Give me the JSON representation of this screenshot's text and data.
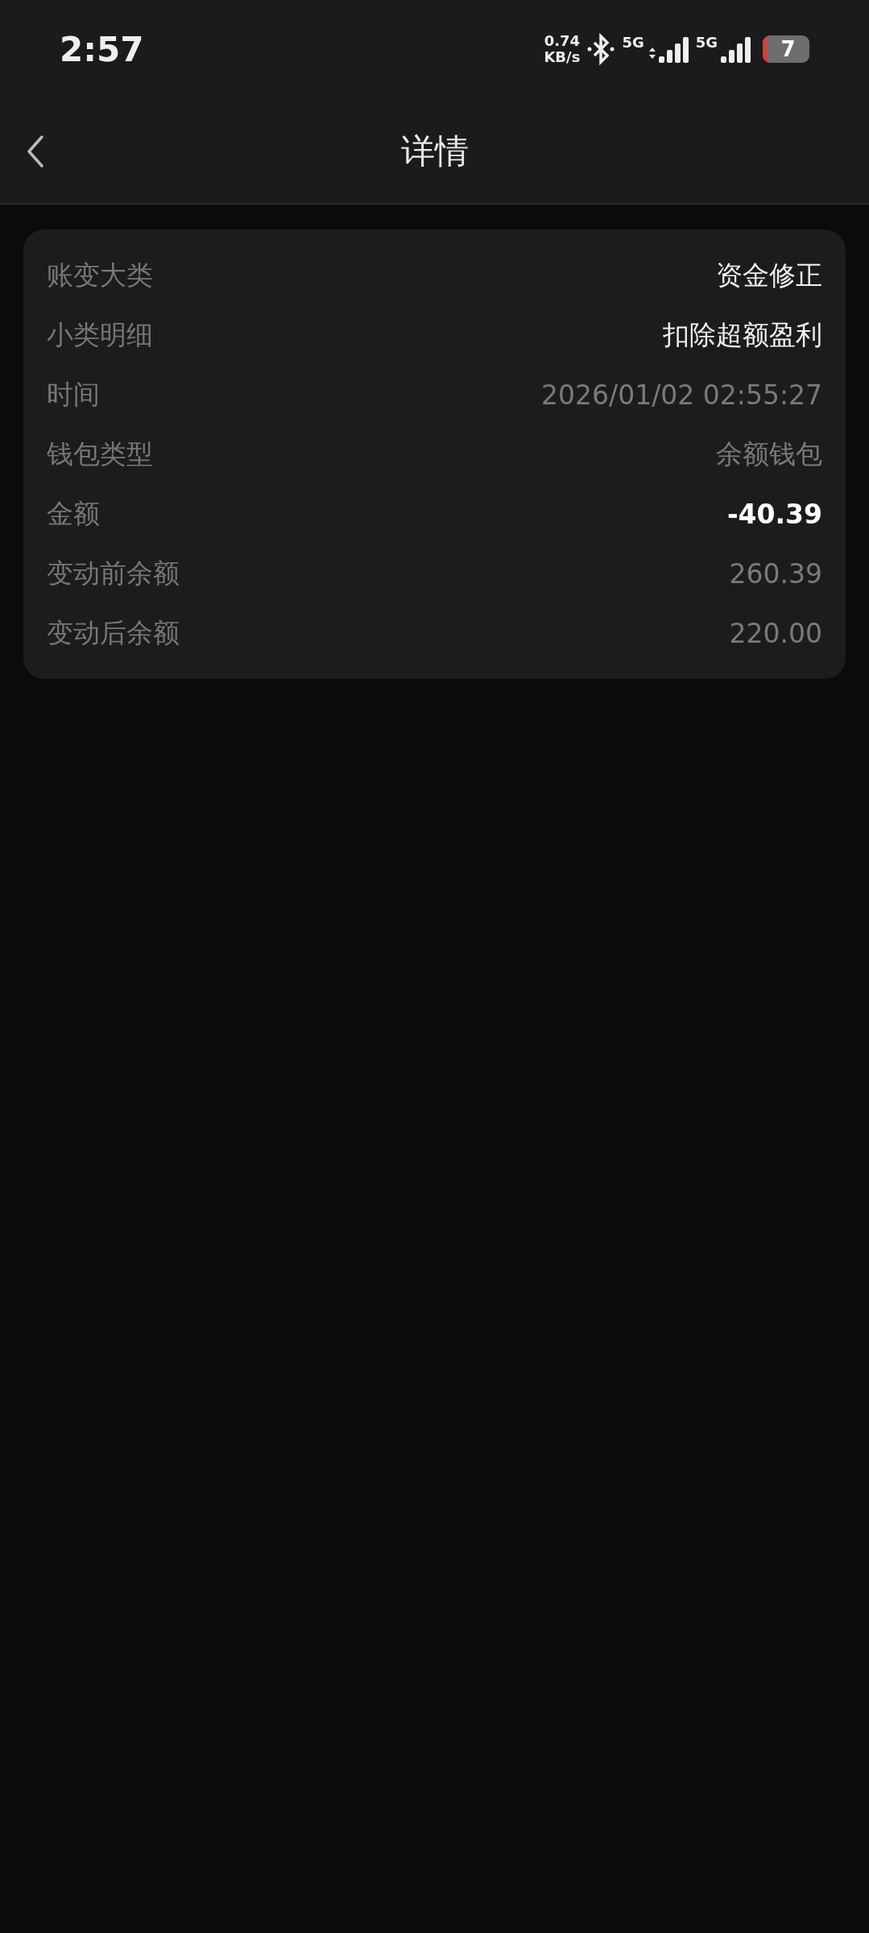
{
  "status_bar": {
    "time": "2:57",
    "speed_value": "0.74",
    "speed_unit": "KB/s",
    "networks": [
      "5G",
      "5G"
    ],
    "battery": "7"
  },
  "header": {
    "title": "详情"
  },
  "details": [
    {
      "label": "账变大类",
      "value": "资金修正",
      "kind": "highlight"
    },
    {
      "label": "小类明细",
      "value": "扣除超额盈利",
      "kind": "highlight"
    },
    {
      "label": "时间",
      "value": "2026/01/02 02:55:27",
      "kind": "plain"
    },
    {
      "label": "钱包类型",
      "value": "余额钱包",
      "kind": "plain"
    },
    {
      "label": "金额",
      "value": "-40.39",
      "kind": "bold"
    },
    {
      "label": "变动前余额",
      "value": "260.39",
      "kind": "plain"
    },
    {
      "label": "变动后余额",
      "value": "220.00",
      "kind": "plain"
    }
  ]
}
